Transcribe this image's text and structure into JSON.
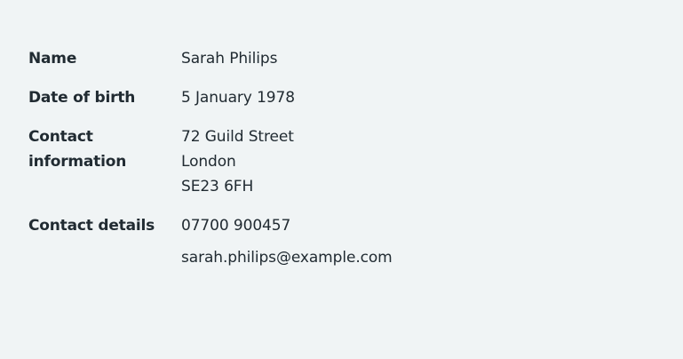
{
  "summary": {
    "rows": [
      {
        "key": "Name",
        "value": [
          "Sarah Philips"
        ]
      },
      {
        "key": "Date of birth",
        "value": [
          "5 January 1978"
        ]
      },
      {
        "key": "Contact information",
        "value": [
          "72 Guild Street",
          "London",
          "SE23 6FH"
        ]
      },
      {
        "key": "Contact details",
        "value": [
          "07700 900457",
          "sarah.philips@example.com"
        ]
      }
    ]
  }
}
